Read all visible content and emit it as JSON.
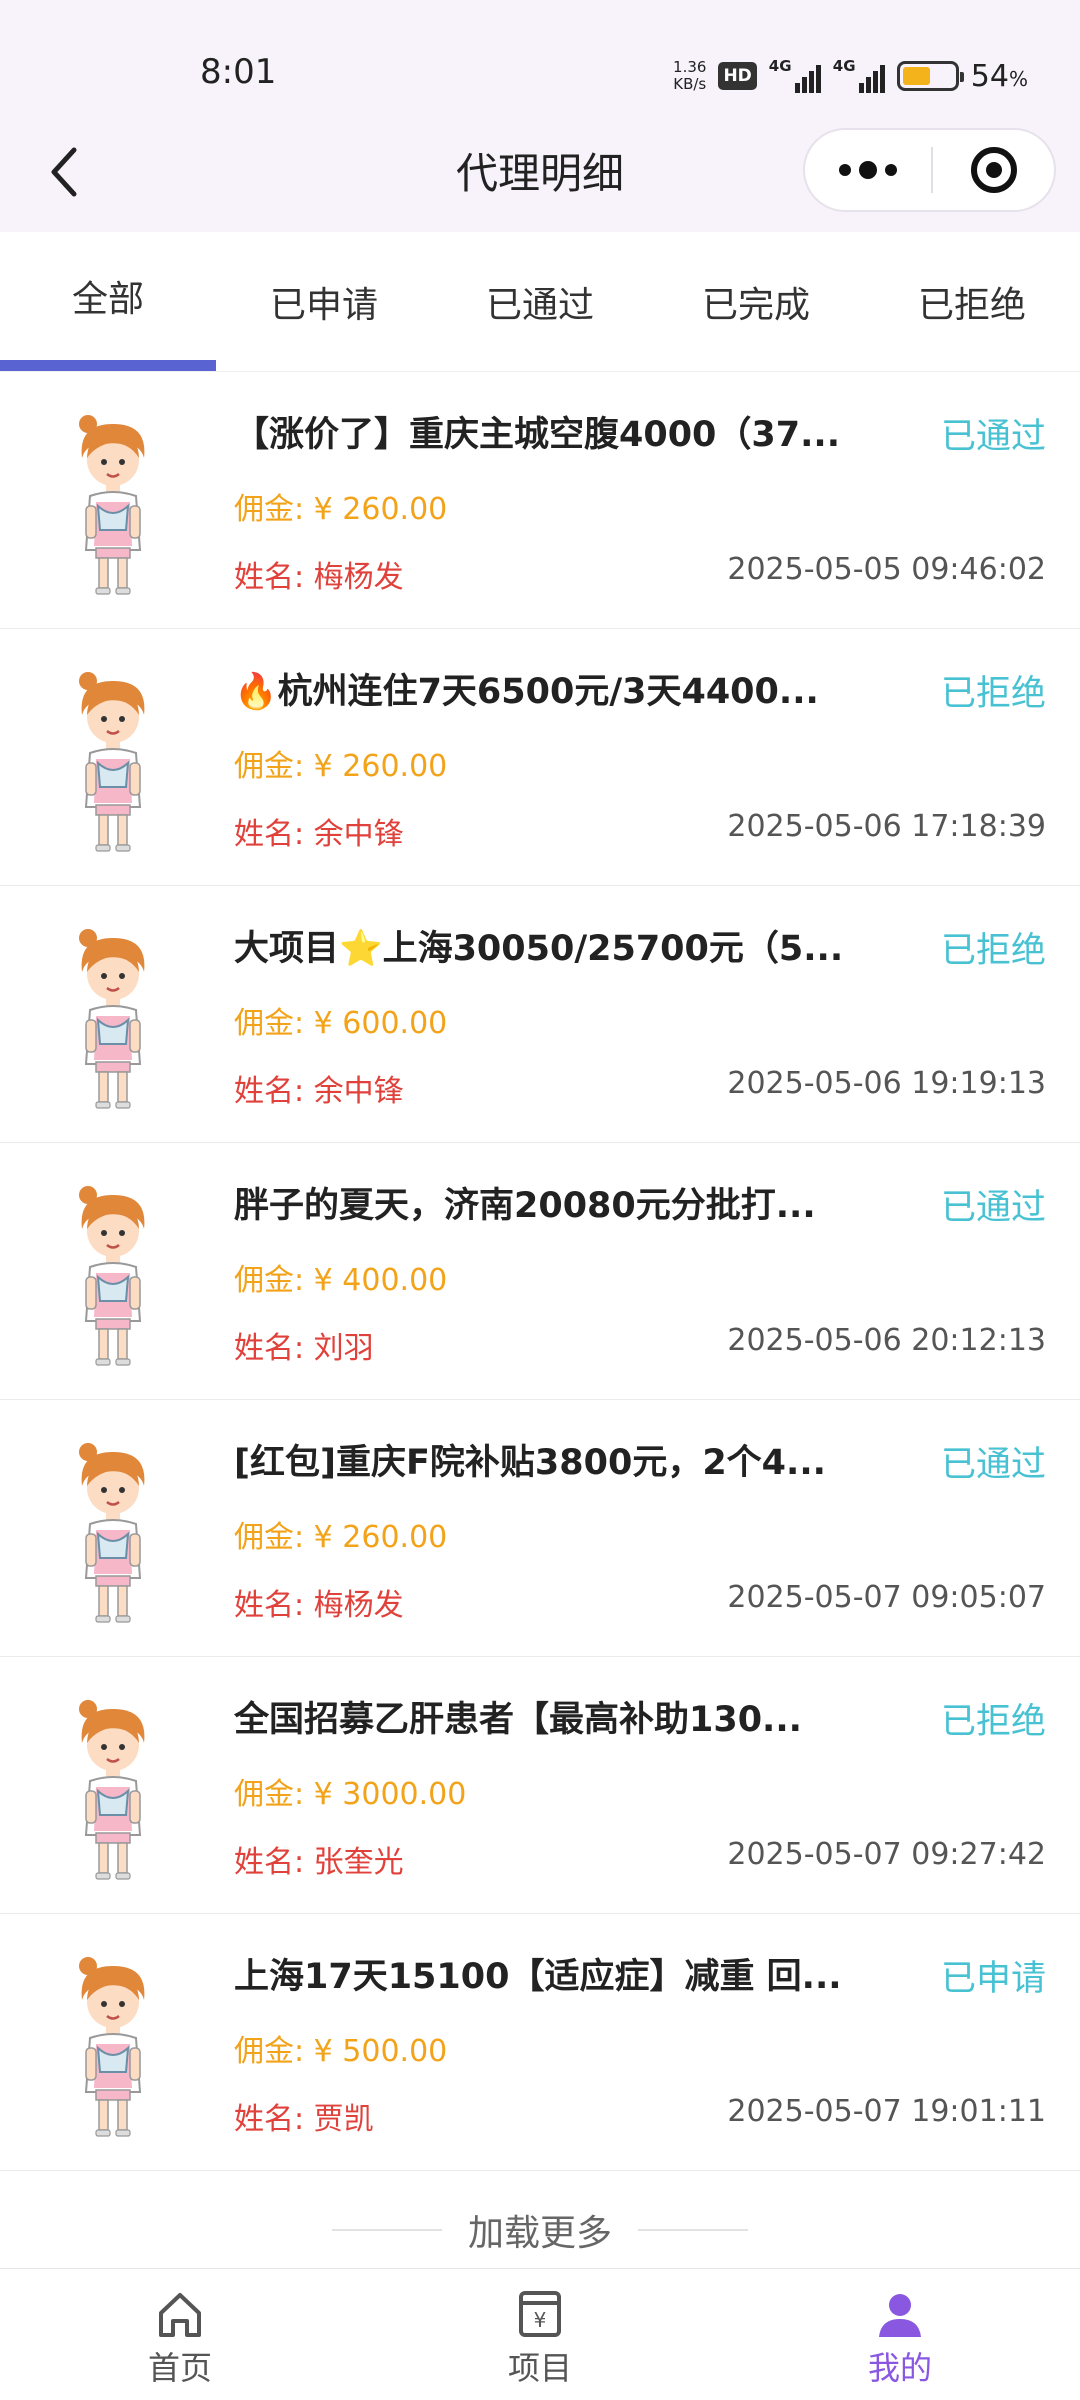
{
  "status_bar": {
    "time": "8:01",
    "net_speed_value": "1.36",
    "net_speed_unit": "KB/s",
    "hd_label": "HD",
    "signal1_label": "4G",
    "signal2_label": "4G",
    "battery_percent": "54",
    "battery_percent_sign": "%",
    "battery_color": "#f4b21b"
  },
  "nav": {
    "title": "代理明细"
  },
  "tabs": [
    {
      "label": "全部",
      "active": true
    },
    {
      "label": "已申请"
    },
    {
      "label": "已通过"
    },
    {
      "label": "已完成"
    },
    {
      "label": "已拒绝"
    }
  ],
  "accent_color": "#5a63d2",
  "items": [
    {
      "title": "【涨价了】重庆主城空腹4000（37...",
      "status": "已通过",
      "commission": "佣金: ¥ 260.00",
      "name": "姓名: 梅杨发",
      "time": "2025-05-05 09:46:02"
    },
    {
      "title": "🔥杭州连住7天6500元/3天4400...",
      "status": "已拒绝",
      "commission": "佣金: ¥ 260.00",
      "name": "姓名: 余中锋",
      "time": "2025-05-06 17:18:39"
    },
    {
      "title": "大项目⭐上海30050/25700元（5...",
      "status": "已拒绝",
      "commission": "佣金: ¥ 600.00",
      "name": "姓名: 余中锋",
      "time": "2025-05-06 19:19:13"
    },
    {
      "title": "胖子的夏天，济南20080元分批打...",
      "status": "已通过",
      "commission": "佣金: ¥ 400.00",
      "name": "姓名: 刘羽",
      "time": "2025-05-06 20:12:13"
    },
    {
      "title": "[红包]重庆F院补贴3800元，2个4...",
      "status": "已通过",
      "commission": "佣金: ¥ 260.00",
      "name": "姓名: 梅杨发",
      "time": "2025-05-07 09:05:07"
    },
    {
      "title": "全国招募乙肝患者【最高补助130...",
      "status": "已拒绝",
      "commission": "佣金: ¥ 3000.00",
      "name": "姓名: 张奎光",
      "time": "2025-05-07 09:27:42"
    },
    {
      "title": "上海17天15100【适应症】减重 回...",
      "status": "已申请",
      "commission": "佣金: ¥ 500.00",
      "name": "姓名: 贾凯",
      "time": "2025-05-07 19:01:11"
    }
  ],
  "load_more": "加载更多",
  "tabbar": [
    {
      "label": "首页",
      "icon": "home-icon"
    },
    {
      "label": "项目",
      "icon": "project-icon"
    },
    {
      "label": "我的",
      "icon": "profile-icon",
      "active": true
    }
  ],
  "colors": {
    "status": "#48c2d3",
    "commission": "#f2a31a",
    "name": "#e0413b",
    "tabbar_active": "#8a58e0"
  }
}
